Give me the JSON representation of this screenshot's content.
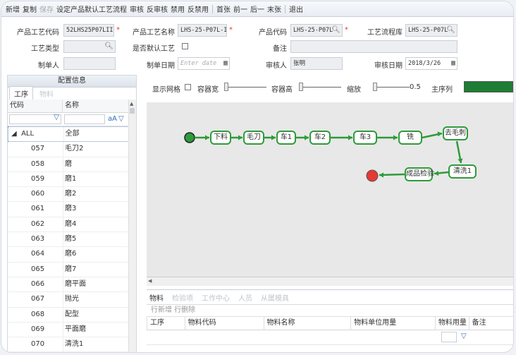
{
  "toolbar": {
    "items": [
      {
        "label": "新增",
        "disabled": false
      },
      {
        "label": "复制",
        "disabled": false
      },
      {
        "label": "保存",
        "disabled": true
      },
      {
        "label": "设定产品默认工艺流程",
        "disabled": false
      },
      {
        "label": "审核",
        "disabled": false
      },
      {
        "label": "反审核",
        "disabled": false
      },
      {
        "label": "禁用",
        "disabled": false
      },
      {
        "label": "反禁用",
        "disabled": false
      },
      {
        "label": "首张",
        "disabled": false
      },
      {
        "label": "前一",
        "disabled": false
      },
      {
        "label": "后一",
        "disabled": false
      },
      {
        "label": "末张",
        "disabled": false
      },
      {
        "label": "退出",
        "disabled": false
      }
    ]
  },
  "form": {
    "process_code_label": "产品工艺代码",
    "process_code_value": "52LHS25P07LII",
    "process_name_label": "产品工艺名称",
    "process_name_value": "LHS-25-P07L-I",
    "product_code_label": "产品代码",
    "product_code_value": "LHS-25-P07L",
    "flow_lib_label": "工艺流程库",
    "flow_lib_value": "LHS-25-P07L",
    "process_type_label": "工艺类型",
    "process_type_value": "",
    "is_default_label": "是否默认工艺",
    "remark_label": "备注",
    "remark_value": "",
    "creator_label": "制单人",
    "creator_value": "",
    "create_date_label": "制单日期",
    "create_date_placeholder": "Enter date",
    "reviewer_label": "审核人",
    "reviewer_value": "张明",
    "review_date_label": "审核日期",
    "review_date_value": "2018/3/26",
    "required_mark": "*"
  },
  "left_panel": {
    "title": "配置信息",
    "tabs": [
      {
        "label": "工序",
        "active": true
      },
      {
        "label": "物料",
        "active": false
      }
    ],
    "col_code": "代码",
    "col_name": "名称",
    "filter_aa": "aA",
    "all_row": {
      "code": "ALL",
      "name": "全部"
    },
    "rows": [
      {
        "code": "057",
        "name": "毛刀2"
      },
      {
        "code": "058",
        "name": "磨"
      },
      {
        "code": "059",
        "name": "磨1"
      },
      {
        "code": "060",
        "name": "磨2"
      },
      {
        "code": "061",
        "name": "磨3"
      },
      {
        "code": "062",
        "name": "磨4"
      },
      {
        "code": "063",
        "name": "磨5"
      },
      {
        "code": "064",
        "name": "磨6"
      },
      {
        "code": "065",
        "name": "磨7"
      },
      {
        "code": "066",
        "name": "磨平面"
      },
      {
        "code": "067",
        "name": "抛光"
      },
      {
        "code": "068",
        "name": "配型"
      },
      {
        "code": "069",
        "name": "平面磨"
      },
      {
        "code": "070",
        "name": "清洗1"
      }
    ]
  },
  "options": {
    "show_grid": "显示网格",
    "container_width": "容器宽",
    "container_height": "容器高",
    "zoom": "缩放",
    "zoom_value": "0.5",
    "main_seq": "主序列"
  },
  "flow": {
    "nodes": [
      {
        "label": "下料"
      },
      {
        "label": "毛刀"
      },
      {
        "label": "车1"
      },
      {
        "label": "车2"
      },
      {
        "label": "车3"
      },
      {
        "label": "铣"
      },
      {
        "label": "去毛刺"
      },
      {
        "label": "清洗1"
      },
      {
        "label": "成品检验"
      }
    ],
    "node_color": "#2e9b3a",
    "start_color": "#2e9b3a",
    "end_color": "#e53935"
  },
  "bottom": {
    "tabs": [
      {
        "label": "物料",
        "active": true
      },
      {
        "label": "检验项",
        "active": false
      },
      {
        "label": "工作中心",
        "active": false
      },
      {
        "label": "人员",
        "active": false
      },
      {
        "label": "从属模具",
        "active": false
      }
    ],
    "add_row": "行新增",
    "del_row": "行删除",
    "cols": [
      "工序",
      "物料代码",
      "物料名称",
      "物料单位用量",
      "物料用量",
      "备注"
    ]
  }
}
